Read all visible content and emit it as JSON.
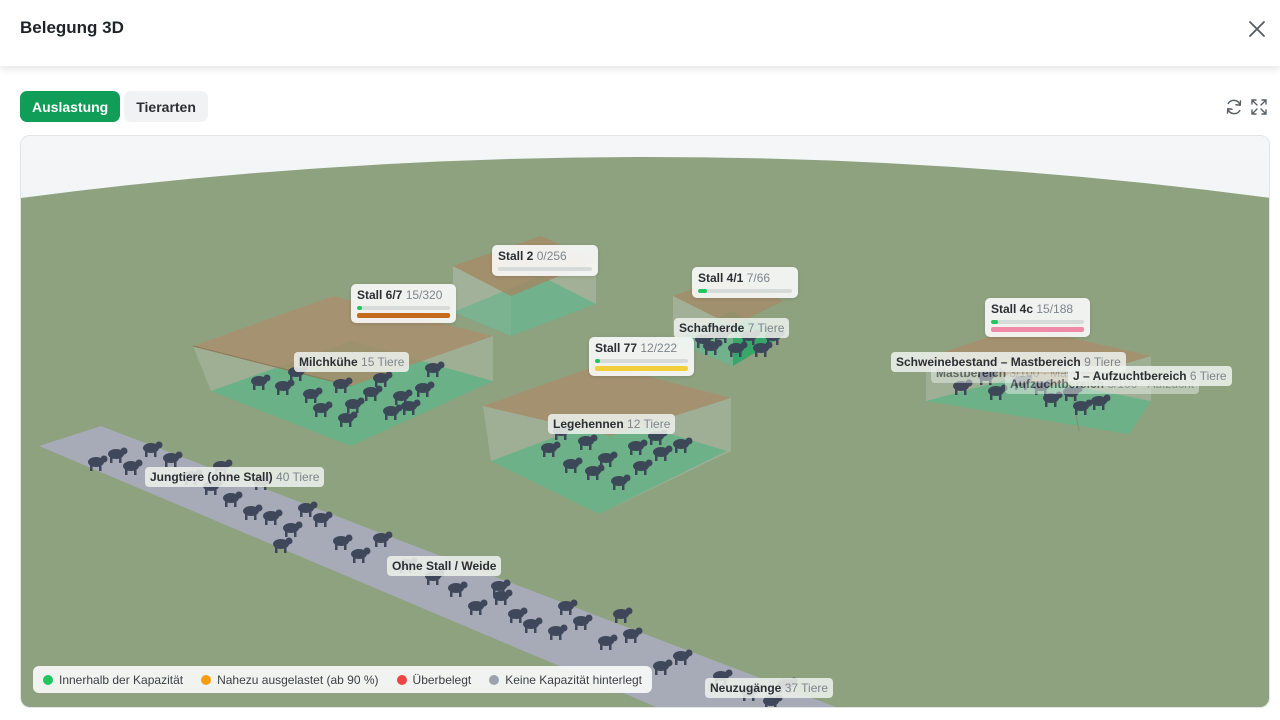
{
  "window": {
    "title": "Belegung 3D",
    "close_icon": "close-icon"
  },
  "tabs": [
    {
      "label": "Auslastung",
      "active": true
    },
    {
      "label": "Tierarten",
      "active": false
    }
  ],
  "toolbar": {
    "refresh_icon": "refresh-icon",
    "fullscreen_icon": "fullscreen-icon"
  },
  "stalls": [
    {
      "name": "Stall 2",
      "capacity": "0/256",
      "fill": 0.0,
      "status_bar_color": ""
    },
    {
      "name": "Stall 6/7",
      "capacity": "15/320",
      "fill": 0.05,
      "status_bar_color": "#c46a1c"
    },
    {
      "name": "Stall 4/1",
      "capacity": "7/66",
      "fill": 0.1,
      "status_bar_color": ""
    },
    {
      "name": "Stall 77",
      "capacity": "12/222",
      "fill": 0.05,
      "status_bar_color": "#f2d03b"
    },
    {
      "name": "Stall 4c",
      "capacity": "15/188",
      "fill": 0.08,
      "status_bar_color": "#f08aa8"
    }
  ],
  "groups": [
    {
      "name": "Milchkühe",
      "count": "15 Tiere"
    },
    {
      "name": "Schafherde",
      "count": "7 Tiere"
    },
    {
      "name": "Legehennen",
      "count": "12 Tiere"
    },
    {
      "name": "Jungtiere (ohne Stall)",
      "count": "40 Tiere"
    },
    {
      "name": "Ohne Stall / Weide",
      "count": ""
    },
    {
      "name": "Neuzugänge",
      "count": "37 Tiere"
    },
    {
      "name": "Schweinebestand – Mastbereich",
      "count": "9 Tiere"
    },
    {
      "name": "J – Aufzuchtbereich",
      "count": "6 Tiere"
    },
    {
      "name": "Mastbereich",
      "count": "3/100 · Mast"
    },
    {
      "name": "Aufzuchtbereich",
      "count": "3/100 · Aufzucht"
    }
  ],
  "legend": [
    {
      "label": "Innerhalb der Kapazität",
      "color": "#22c55e"
    },
    {
      "label": "Nahezu ausgelastet (ab 90 %)",
      "color": "#f59e0b"
    },
    {
      "label": "Überbelegt",
      "color": "#ef4444"
    },
    {
      "label": "Keine Kapazität hinterlegt",
      "color": "#9ca3af"
    }
  ]
}
